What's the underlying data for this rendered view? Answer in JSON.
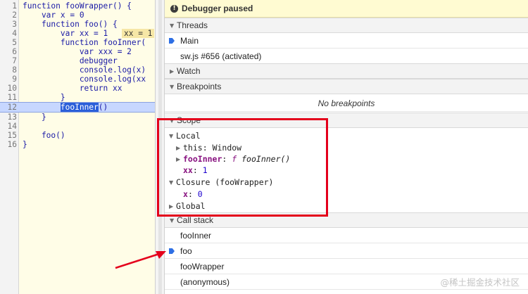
{
  "editor": {
    "lines": [
      {
        "num": "1",
        "code": "function fooWrapper() {"
      },
      {
        "num": "2",
        "code": "    var x = 0"
      },
      {
        "num": "3",
        "code": "    function foo() {"
      },
      {
        "num": "4",
        "code": "        var xx = 1",
        "inline": "xx = 1"
      },
      {
        "num": "5",
        "code": "        function fooInner("
      },
      {
        "num": "6",
        "code": "            var xxx = 2"
      },
      {
        "num": "7",
        "code": "            debugger"
      },
      {
        "num": "8",
        "code": "            console.log(x)"
      },
      {
        "num": "9",
        "code": "            console.log(xx"
      },
      {
        "num": "10",
        "code": "            return xx"
      },
      {
        "num": "11",
        "code": "        }"
      },
      {
        "num": "12",
        "code_prefix": "        ",
        "code_hl": "fooInner",
        "code_suffix": "()",
        "current": true
      },
      {
        "num": "13",
        "code": "    }"
      },
      {
        "num": "14",
        "code": ""
      },
      {
        "num": "15",
        "code": "    foo()"
      },
      {
        "num": "16",
        "code": "}"
      }
    ]
  },
  "debugger": {
    "banner": "Debugger paused",
    "banner_icon": "info-icon",
    "threads": {
      "header": "Threads",
      "items": [
        {
          "label": "Main",
          "selected": true
        },
        {
          "label": "sw.js #656 (activated)",
          "selected": false
        }
      ]
    },
    "watch": {
      "header": "Watch"
    },
    "breakpoints": {
      "header": "Breakpoints",
      "empty": "No breakpoints"
    },
    "scope": {
      "header": "Scope",
      "local_label": "Local",
      "this_name": "this",
      "this_sep": ": ",
      "this_value": "Window",
      "fooinner_name": "fooInner",
      "fooinner_sep": ": ",
      "fooinner_f": "f",
      "fooinner_value": "fooInner()",
      "xx_name": "xx",
      "xx_sep": ": ",
      "xx_value": "1",
      "closure_label": "Closure (fooWrapper)",
      "x_name": "x",
      "x_sep": ": ",
      "x_value": "0",
      "global_label": "Global"
    },
    "call_stack": {
      "header": "Call stack",
      "frames": [
        {
          "label": "fooInner",
          "selected": false
        },
        {
          "label": "foo",
          "selected": true
        },
        {
          "label": "fooWrapper",
          "selected": false
        },
        {
          "label": "(anonymous)",
          "selected": false
        }
      ]
    }
  },
  "watermark": "@稀土掘金技术社区",
  "colors": {
    "highlight_box": "#e4001b",
    "arrow": "#e4001b",
    "selected_marker": "#2e6fe4",
    "banner_bg": "#fffbd2"
  }
}
